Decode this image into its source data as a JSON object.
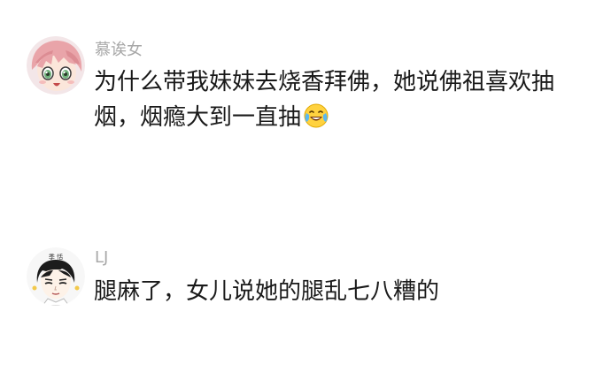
{
  "comments": [
    {
      "username": "慕诶女",
      "content": "为什么带我妹妹去烧香拜佛，她说佛祖喜欢抽烟，烟瘾大到一直抽",
      "trailing_icon": "crying-laughing-emoji-icon",
      "avatar_icon": "anime-girl-pink-hair-avatar"
    },
    {
      "username": "LJ",
      "content": "腿麻了，女儿说她的腿乱七八糟的",
      "avatar_icon": "cartoon-black-hair-boy-avatar",
      "avatar_text": "季 恬"
    }
  ],
  "colors": {
    "username": "#a8a8a8",
    "content": "#1a1a1a",
    "background": "#ffffff"
  }
}
